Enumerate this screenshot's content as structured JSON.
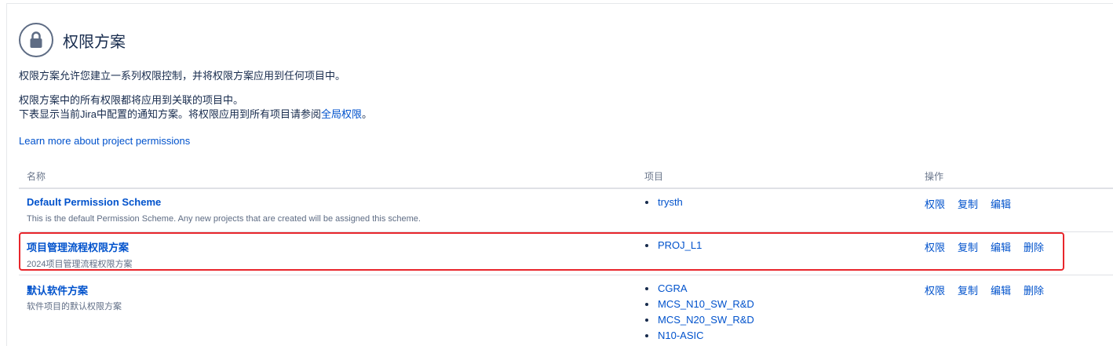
{
  "header": {
    "title": "权限方案",
    "icon": "lock-icon"
  },
  "description": {
    "line1": "权限方案允许您建立一系列权限控制，并将权限方案应用到任何项目中。",
    "line2": "权限方案中的所有权限都将应用到关联的项目中。",
    "line3_prefix": "下表显示当前Jira中配置的通知方案。将权限应用到所有项目请参阅",
    "line3_link": "全局权限",
    "line3_suffix": "。",
    "learn_more": "Learn more about project permissions"
  },
  "table": {
    "headers": {
      "name": "名称",
      "projects": "项目",
      "actions": "操作"
    },
    "rows": [
      {
        "name": "Default Permission Scheme",
        "description": "This is the default Permission Scheme. Any new projects that are created will be assigned this scheme.",
        "projects": [
          "trysth"
        ],
        "actions": [
          "权限",
          "复制",
          "编辑"
        ]
      },
      {
        "name": "项目管理流程权限方案",
        "description": "2024项目管理流程权限方案",
        "projects": [
          "PROJ_L1"
        ],
        "actions": [
          "权限",
          "复制",
          "编辑",
          "删除"
        ]
      },
      {
        "name": "默认软件方案",
        "description": "软件项目的默认权限方案",
        "projects": [
          "CGRA",
          "MCS_N10_SW_R&D",
          "MCS_N20_SW_R&D",
          "N10-ASIC"
        ],
        "actions": [
          "权限",
          "复制",
          "编辑",
          "删除"
        ]
      }
    ]
  },
  "colors": {
    "link": "#0052cc",
    "text": "#172b4d",
    "highlight": "#e8262c"
  }
}
